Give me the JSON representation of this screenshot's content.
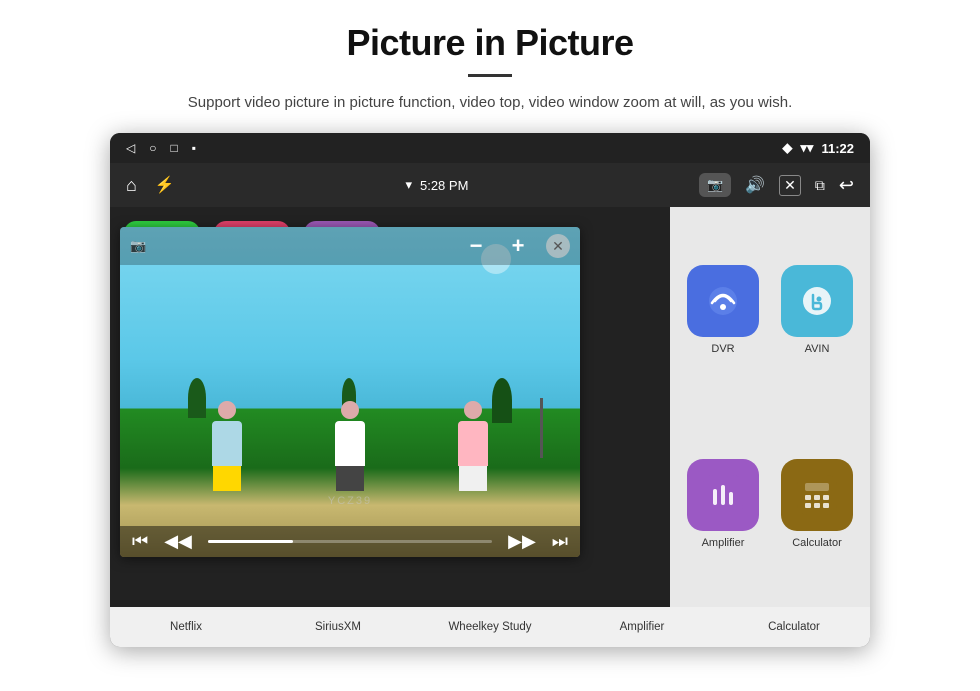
{
  "page": {
    "title": "Picture in Picture",
    "subtitle": "Support video picture in picture function, video top, video window zoom at will, as you wish."
  },
  "statusBar": {
    "time": "11:22",
    "icons": [
      "back-arrow",
      "home-circle",
      "square",
      "menu"
    ]
  },
  "toolbar": {
    "time": "5:28 PM",
    "icons": [
      "home",
      "usb",
      "wifi",
      "camera",
      "volume",
      "close-x",
      "pip",
      "back"
    ]
  },
  "pipControls": {
    "minus": "−",
    "plus": "+",
    "close": "✕"
  },
  "transportControls": {
    "prev": "⏮",
    "rewind": "◀◀",
    "play": "▶",
    "forward": "▶▶",
    "next": "⏭"
  },
  "apps": {
    "behind": [
      {
        "label": "Netflix",
        "color": "#2ecc40"
      },
      {
        "label": "SiriusXM",
        "color": "#e0406a"
      },
      {
        "label": "Wheelkey Study",
        "color": "#9b59b6"
      }
    ],
    "right": [
      {
        "label": "DVR",
        "color": "#4a6ee0",
        "icon": "📡"
      },
      {
        "label": "AVIN",
        "color": "#4ab8d8",
        "icon": "🔌"
      },
      {
        "label": "Amplifier",
        "color": "#9b59c4",
        "icon": "🎛"
      },
      {
        "label": "Calculator",
        "color": "#8B6914",
        "icon": "🖩"
      }
    ],
    "bottom": [
      "Netflix",
      "SiriusXM",
      "Wheelkey Study",
      "Amplifier",
      "Calculator"
    ]
  },
  "watermark": "YCZ39"
}
